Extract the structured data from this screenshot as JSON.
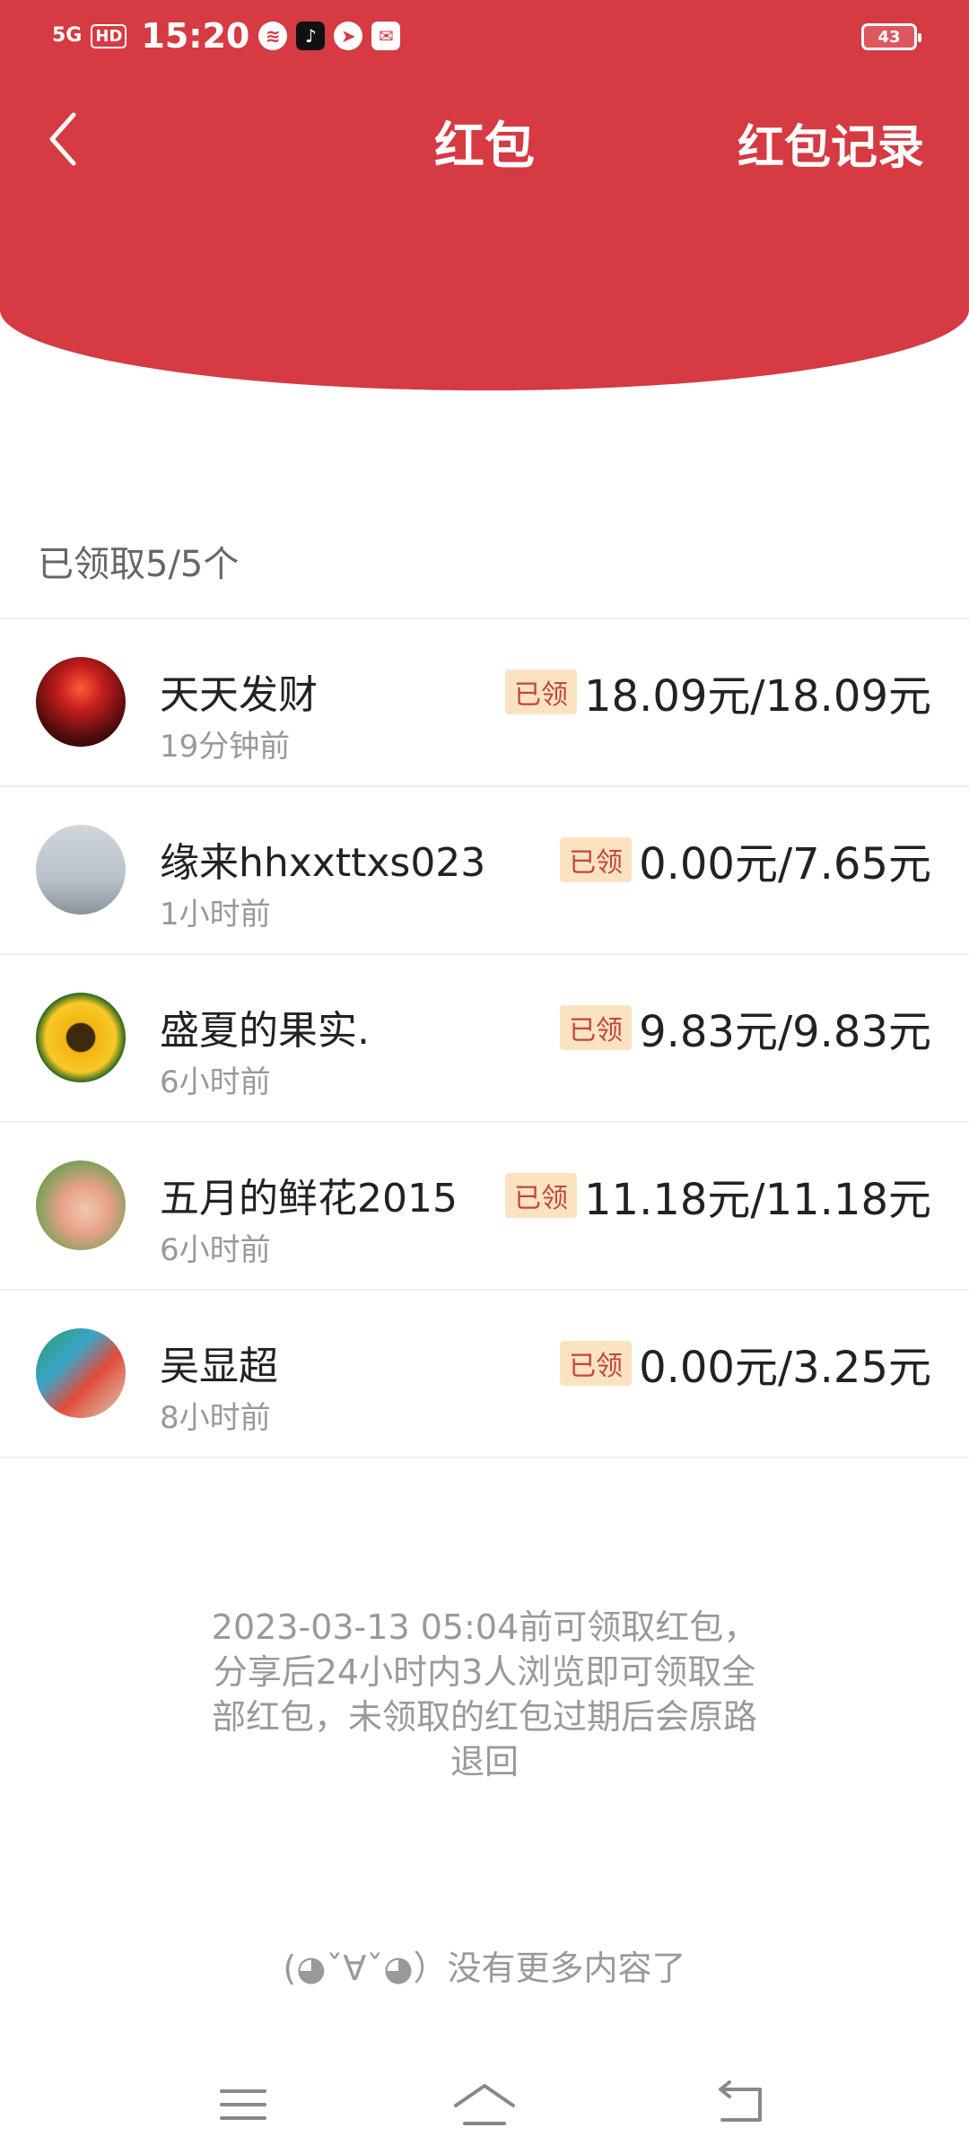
{
  "status_bar": {
    "network": "5G",
    "hd": "HD",
    "time": "15:20",
    "battery": "43"
  },
  "header": {
    "title": "红包",
    "record_label": "红包记录"
  },
  "summary": "已领取5/5个",
  "claims": [
    {
      "name": "天天发财",
      "time": "19分钟前",
      "badge": "已领",
      "amount": "18.09元/18.09元"
    },
    {
      "name": "缘来hhxxttxs023",
      "time": "1小时前",
      "badge": "已领",
      "amount": "0.00元/7.65元"
    },
    {
      "name": "盛夏的果实.",
      "time": "6小时前",
      "badge": "已领",
      "amount": "9.83元/9.83元"
    },
    {
      "name": "五月的鲜花2015",
      "time": "6小时前",
      "badge": "已领",
      "amount": "11.18元/11.18元"
    },
    {
      "name": "吴显超",
      "time": "8小时前",
      "badge": "已领",
      "amount": "0.00元/3.25元"
    }
  ],
  "notice": "2023-03-13  05:04前可领取红包，分享后24小时内3人浏览即可领取全部红包，未领取的红包过期后会原路退回",
  "no_more": "(◕ˇ∀ˇ◕）没有更多内容了",
  "colors": {
    "header_red": "#d63a42",
    "badge_bg": "#fbe3c2",
    "badge_text": "#c2453b"
  }
}
